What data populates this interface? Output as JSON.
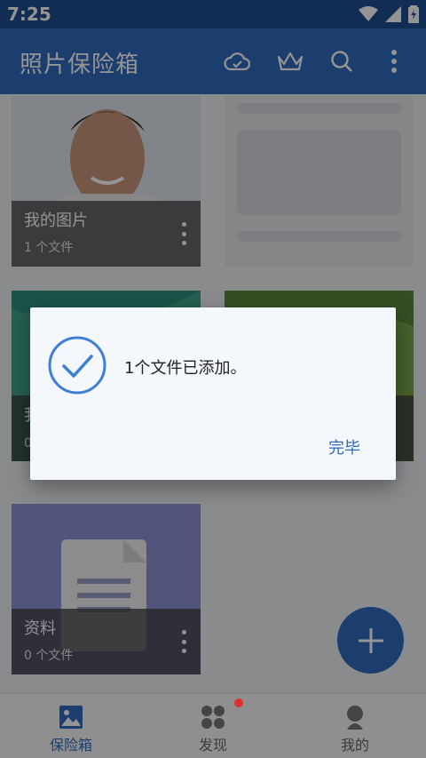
{
  "status_bar": {
    "time": "7:25"
  },
  "app_bar": {
    "title": "照片保险箱",
    "icons": [
      "cloud-icon",
      "crown-icon",
      "search-icon",
      "more-vert-icon"
    ]
  },
  "albums": [
    {
      "name": "我的图片",
      "count": "1 个文件"
    },
    {
      "name": "我",
      "count": "0"
    },
    {
      "name": "资料",
      "count": "0 个文件"
    }
  ],
  "bottom_nav": {
    "items": [
      {
        "label": "保险箱",
        "icon": "image-icon"
      },
      {
        "label": "发现",
        "icon": "apps-icon"
      },
      {
        "label": "我的",
        "icon": "person-icon"
      }
    ]
  },
  "dialog": {
    "message": "1个文件已添加。",
    "done_label": "完毕"
  },
  "colors": {
    "primary": "#2f6bbd",
    "status_bar": "#1f4f8f",
    "badge": "#e03030"
  }
}
